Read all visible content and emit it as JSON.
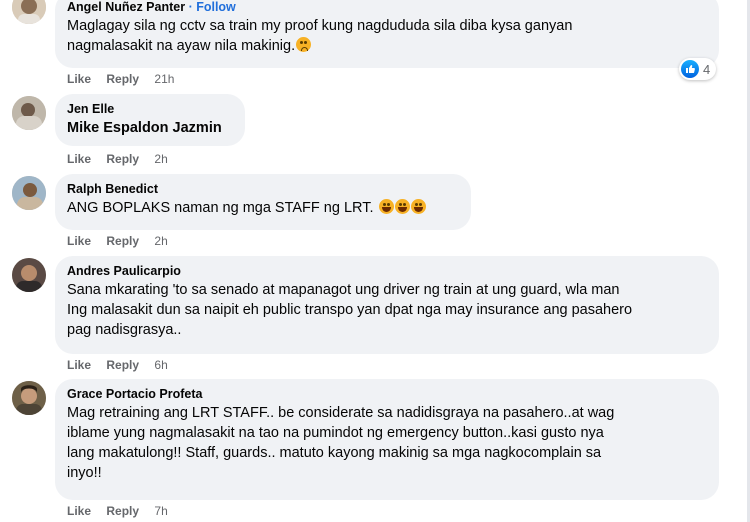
{
  "colors": {
    "bubble_bg": "#f0f2f5",
    "link_blue": "#216fdb",
    "action_gray": "#65676b",
    "like_blue": "#0866ff"
  },
  "action_labels": {
    "like": "Like",
    "reply": "Reply"
  },
  "comments": [
    {
      "author": "Angel Nuñez Panter",
      "follow": "· Follow",
      "lines": [
        "Maglagay sila ng cctv sa train my proof kung nagdududa sila diba kysa ganyan",
        "nagmalasakit na ayaw nila makinig."
      ],
      "emoji": "sad-emoji",
      "time": "21h",
      "reactions": {
        "icon": "like-icon",
        "count": "4"
      }
    },
    {
      "author": "Jen Elle",
      "lines": [
        "Mike Espaldon Jazmin"
      ],
      "time": "2h"
    },
    {
      "author": "Ralph Benedict",
      "lines": [
        "ANG BOPLAKS naman ng mga STAFF ng LRT."
      ],
      "emoji": "laughing-crying-emoji x3",
      "time": "2h"
    },
    {
      "author": "Andres Paulicarpio",
      "lines": [
        "Sana mkarating 'to sa senado at mapanagot ung driver ng train at ung guard, wla man",
        "Ing malasakit dun sa naipit eh public transpo yan dpat nga may insurance ang pasahero",
        "pag nadisgrasya.."
      ],
      "time": "6h"
    },
    {
      "author": "Grace Portacio Profeta",
      "lines": [
        "Mag retraining ang LRT STAFF.. be considerate sa nadidisgraya na pasahero..at wag",
        "iblame yung nagmalasakit na tao na pumindot ng emergency button..kasi gusto nya",
        "lang makatulong!! Staff, guards.. matuto kayong makinig sa mga nagkocomplain sa",
        "inyo!!"
      ],
      "time": "7h"
    }
  ]
}
